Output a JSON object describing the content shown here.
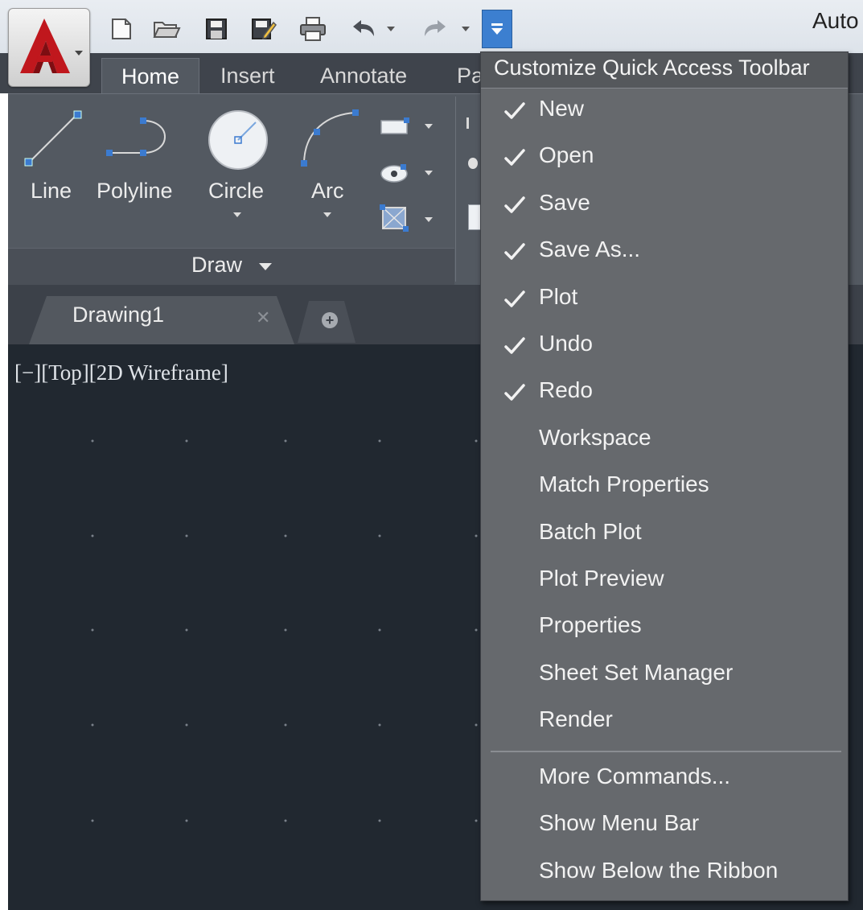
{
  "window": {
    "title": "Auto"
  },
  "quick_access_toolbar": {
    "buttons": [
      "new-icon",
      "open-icon",
      "save-icon",
      "save-as-icon",
      "plot-icon",
      "undo-icon",
      "redo-icon",
      "customize-dropdown-icon"
    ]
  },
  "ribbon": {
    "tabs": [
      "Home",
      "Insert",
      "Annotate",
      "Pa"
    ],
    "active_tab": "Home",
    "draw_panel": {
      "title": "Draw",
      "tools": [
        "Line",
        "Polyline",
        "Circle",
        "Arc"
      ]
    }
  },
  "document_tabs": {
    "active": "Drawing1",
    "close_glyph": "✕",
    "new_tab_glyph": "+"
  },
  "viewport": {
    "label": "[−][Top][2D Wireframe]"
  },
  "customize_menu": {
    "title": "Customize Quick Access Toolbar",
    "items": [
      {
        "label": "New",
        "checked": true
      },
      {
        "label": "Open",
        "checked": true
      },
      {
        "label": "Save",
        "checked": true
      },
      {
        "label": "Save As...",
        "checked": true
      },
      {
        "label": "Plot",
        "checked": true
      },
      {
        "label": "Undo",
        "checked": true
      },
      {
        "label": "Redo",
        "checked": true
      },
      {
        "label": "Workspace",
        "checked": false
      },
      {
        "label": "Match Properties",
        "checked": false
      },
      {
        "label": "Batch Plot",
        "checked": false
      },
      {
        "label": "Plot Preview",
        "checked": false
      },
      {
        "label": "Properties",
        "checked": false
      },
      {
        "label": "Sheet Set Manager",
        "checked": false
      },
      {
        "label": "Render",
        "checked": false
      }
    ],
    "footer_items": [
      "More Commands...",
      "Show Menu Bar",
      "Show Below the Ribbon"
    ]
  },
  "colors": {
    "menu_bg": "#66696d",
    "ribbon_bg": "#535961",
    "viewport_bg": "#212830",
    "accent_blue": "#3c7fd0",
    "app_logo_red": "#c0171d"
  }
}
